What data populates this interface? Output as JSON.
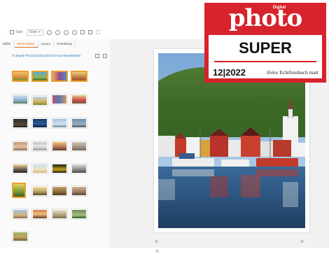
{
  "toolbar": {
    "start_label": "Start",
    "date_label": "Datei",
    "date_arrow": "▾"
  },
  "tabs": [
    "Bilder",
    "Meine Bilder",
    "Layout",
    "Gestaltung"
  ],
  "folder_path": "D:\\Digital Photos\\2022\\10\\22\\Versuch\\Beidebilder",
  "badge": {
    "brand_small": "Digital",
    "brand": "photo",
    "rating": "SUPER",
    "issue": "12|2022",
    "product": "ifolor Echtfotobuch matt"
  },
  "colors": {
    "badge_red": "#d7232b",
    "selection_orange": "#f0a02a",
    "active_tab": "#e26c1a",
    "link_blue": "#2d7fc1"
  }
}
